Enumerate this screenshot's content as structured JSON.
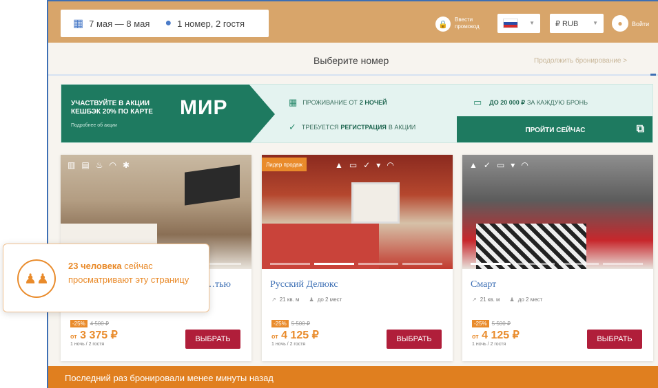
{
  "search": {
    "dates": "7 мая — 8 мая",
    "guests": "1 номер, 2 гостя"
  },
  "header": {
    "promo_line1": "Ввести",
    "promo_line2": "промокод",
    "currency": "₽ RUB",
    "login": "Войти"
  },
  "steps": {
    "current": "Выберите номер",
    "next": "Продолжить бронирование >"
  },
  "banner": {
    "title_line1": "УЧАСТВУЙТЕ В АКЦИИ",
    "title_line2": "КЕШБЭК 20% ПО КАРТЕ",
    "brand": "МИР",
    "more": "Подробнее об акции",
    "item1_pre": "ПРОЖИВАНИЕ ОТ",
    "item1_bold": "2 НОЧЕЙ",
    "item2_pre": "ТРЕБУЕТСЯ",
    "item2_bold": "РЕГИСТРАЦИЯ",
    "item2_post": "В АКЦИИ",
    "item3_bold": "ДО 20 000 ₽",
    "item3_post": "ЗА КАЖДУЮ БРОНЬ",
    "cta": "ПРОЙТИ СЕЙЧАС"
  },
  "rooms": [
    {
      "name": "…тью",
      "area": "",
      "capacity": "",
      "discount": "-25%",
      "old_price": "4 500 ₽",
      "price_prefix": "от",
      "price": "3 375 ₽",
      "per_night": "1 ночь / 2 гостя",
      "select": "ВЫБРАТЬ"
    },
    {
      "badge": "Лидер продаж",
      "name": "Русский Делюкс",
      "area": "21 кв. м",
      "capacity": "до 2 мест",
      "discount": "-25%",
      "old_price": "5 500 ₽",
      "price_prefix": "от",
      "price": "4 125 ₽",
      "per_night": "1 ночь / 2 гостя",
      "select": "ВЫБРАТЬ"
    },
    {
      "name": "Смарт",
      "area": "21 кв. м",
      "capacity": "до 2 мест",
      "discount": "-25%",
      "old_price": "5 500 ₽",
      "price_prefix": "от",
      "price": "4 125 ₽",
      "per_night": "1 ночь / 2 гостя",
      "select": "ВЫБРАТЬ"
    }
  ],
  "popup": {
    "count": "23 человека",
    "text": "сейчас просматривают эту страницу"
  },
  "footer": {
    "text": "Последний раз бронировали менее минуты назад"
  },
  "colors": {
    "header": "#d8a56a",
    "accent": "#e98b2b",
    "select_button": "#b01e3a",
    "banner_green": "#1e7a60",
    "link_blue": "#3d6fb4"
  }
}
